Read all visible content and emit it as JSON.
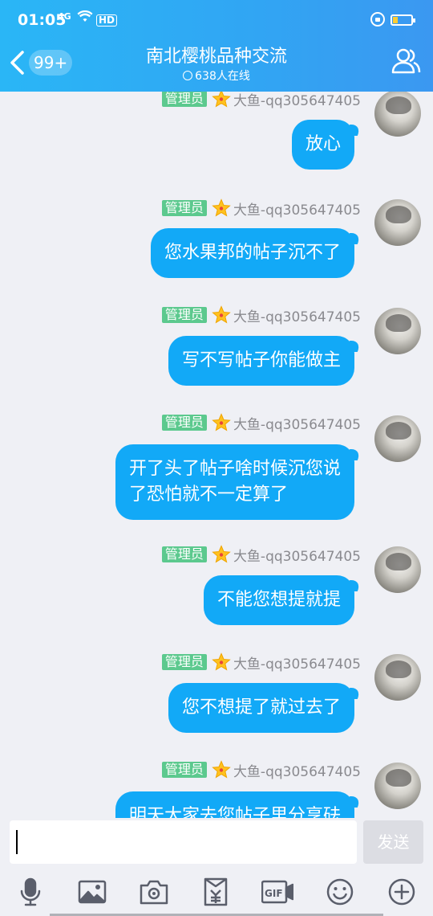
{
  "status_bar": {
    "time": "01:05",
    "signal": "4G",
    "hd": "HD",
    "icons": [
      "signal-icon",
      "wifi-icon",
      "hd-icon",
      "lock-icon",
      "battery-icon"
    ]
  },
  "header": {
    "back_icon": "chevron-left-icon",
    "unread_badge": "99+",
    "title": "南北樱桃品种交流",
    "online_count": "638人在线",
    "members_icon": "people-icon"
  },
  "messages": [
    {
      "role": "管理员",
      "sender": "大鱼-qq305647405",
      "text": [
        "放心"
      ]
    },
    {
      "role": "管理员",
      "sender": "大鱼-qq305647405",
      "text": [
        "您水果邦的帖子沉不了"
      ]
    },
    {
      "role": "管理员",
      "sender": "大鱼-qq305647405",
      "text": [
        "写不写帖子你能做主"
      ]
    },
    {
      "role": "管理员",
      "sender": "大鱼-qq305647405",
      "text": [
        "开了头了帖子啥时候沉您说",
        "了恐怕就不一定算了"
      ]
    },
    {
      "role": "管理员",
      "sender": "大鱼-qq305647405",
      "text": [
        "不能您想提就提"
      ]
    },
    {
      "role": "管理员",
      "sender": "大鱼-qq305647405",
      "text": [
        "您不想提了就过去了"
      ]
    },
    {
      "role": "管理员",
      "sender": "大鱼-qq305647405",
      "text": [
        "明天大家去您帖子里分享砝"
      ]
    }
  ],
  "input": {
    "value": "",
    "send_label": "发送"
  },
  "toolbar": {
    "icons": [
      "microphone-icon",
      "image-icon",
      "camera-icon",
      "red-packet-icon",
      "gif-icon",
      "emoji-icon",
      "plus-icon"
    ]
  },
  "colors": {
    "header_start": "#2ab6f6",
    "header_end": "#3b98f1",
    "bubble": "#12a9f7",
    "admin_tag": "#5cc98e",
    "chat_bg": "#eff0f5"
  }
}
